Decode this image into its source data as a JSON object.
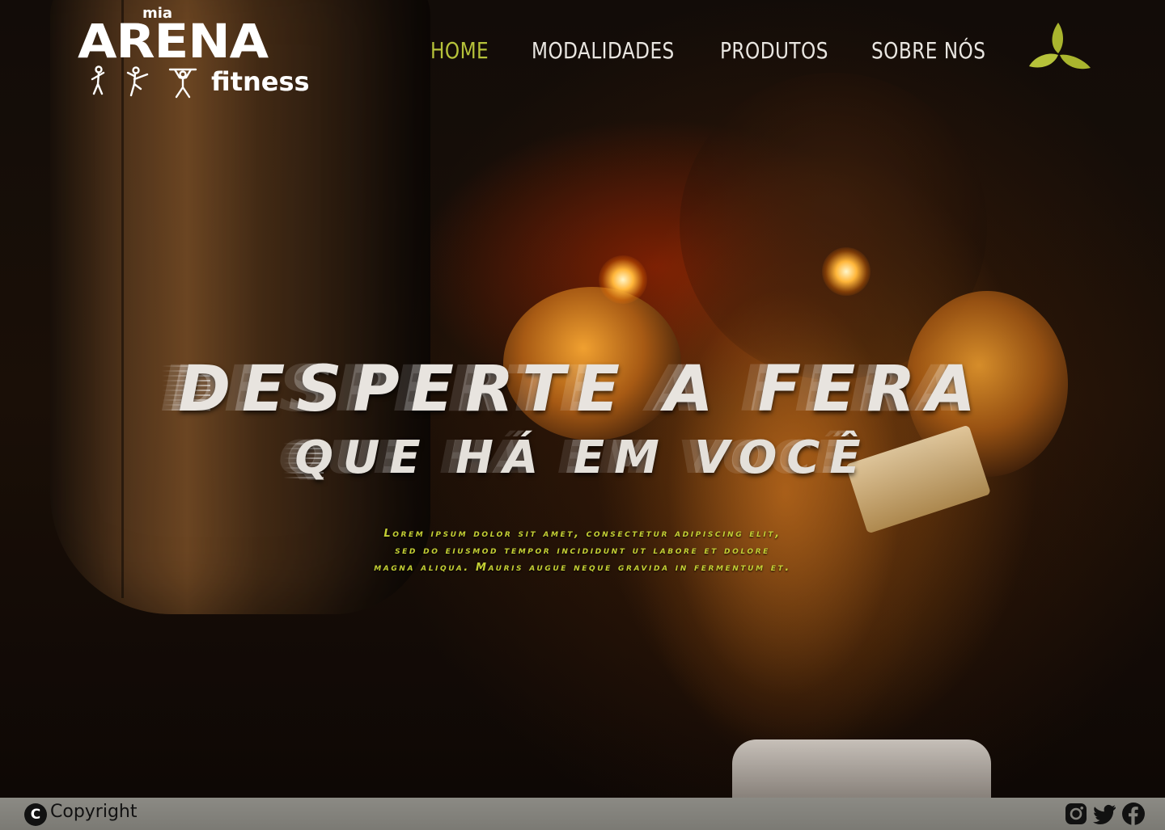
{
  "logo": {
    "small": "mia",
    "main": "ARENA",
    "sub": "fitness"
  },
  "nav": {
    "items": [
      {
        "label": "HOME",
        "active": true
      },
      {
        "label": "MODALIDADES",
        "active": false
      },
      {
        "label": "PRODUTOS",
        "active": false
      },
      {
        "label": "SOBRE NÓS",
        "active": false
      }
    ]
  },
  "hero": {
    "headline": "DESPERTE A FERA",
    "subheadline": "QUE HÁ EM VOCÊ",
    "description_lines": [
      "Lorem ipsum dolor sit amet, consectetur adipiscing elit,",
      "sed do eiusmod tempor incididunt ut labore et dolore",
      "magna aliqua. Mauris augue neque gravida in fermentum et."
    ]
  },
  "footer": {
    "copyright_symbol": "C",
    "copyright_label": "Copyright",
    "social_icons": [
      "instagram-icon",
      "twitter-icon",
      "facebook-icon"
    ]
  },
  "colors": {
    "accent": "#b6c23a",
    "nav_text": "#e9e6e1",
    "footer_bg": "#85847e",
    "description": "#c4cf34"
  }
}
